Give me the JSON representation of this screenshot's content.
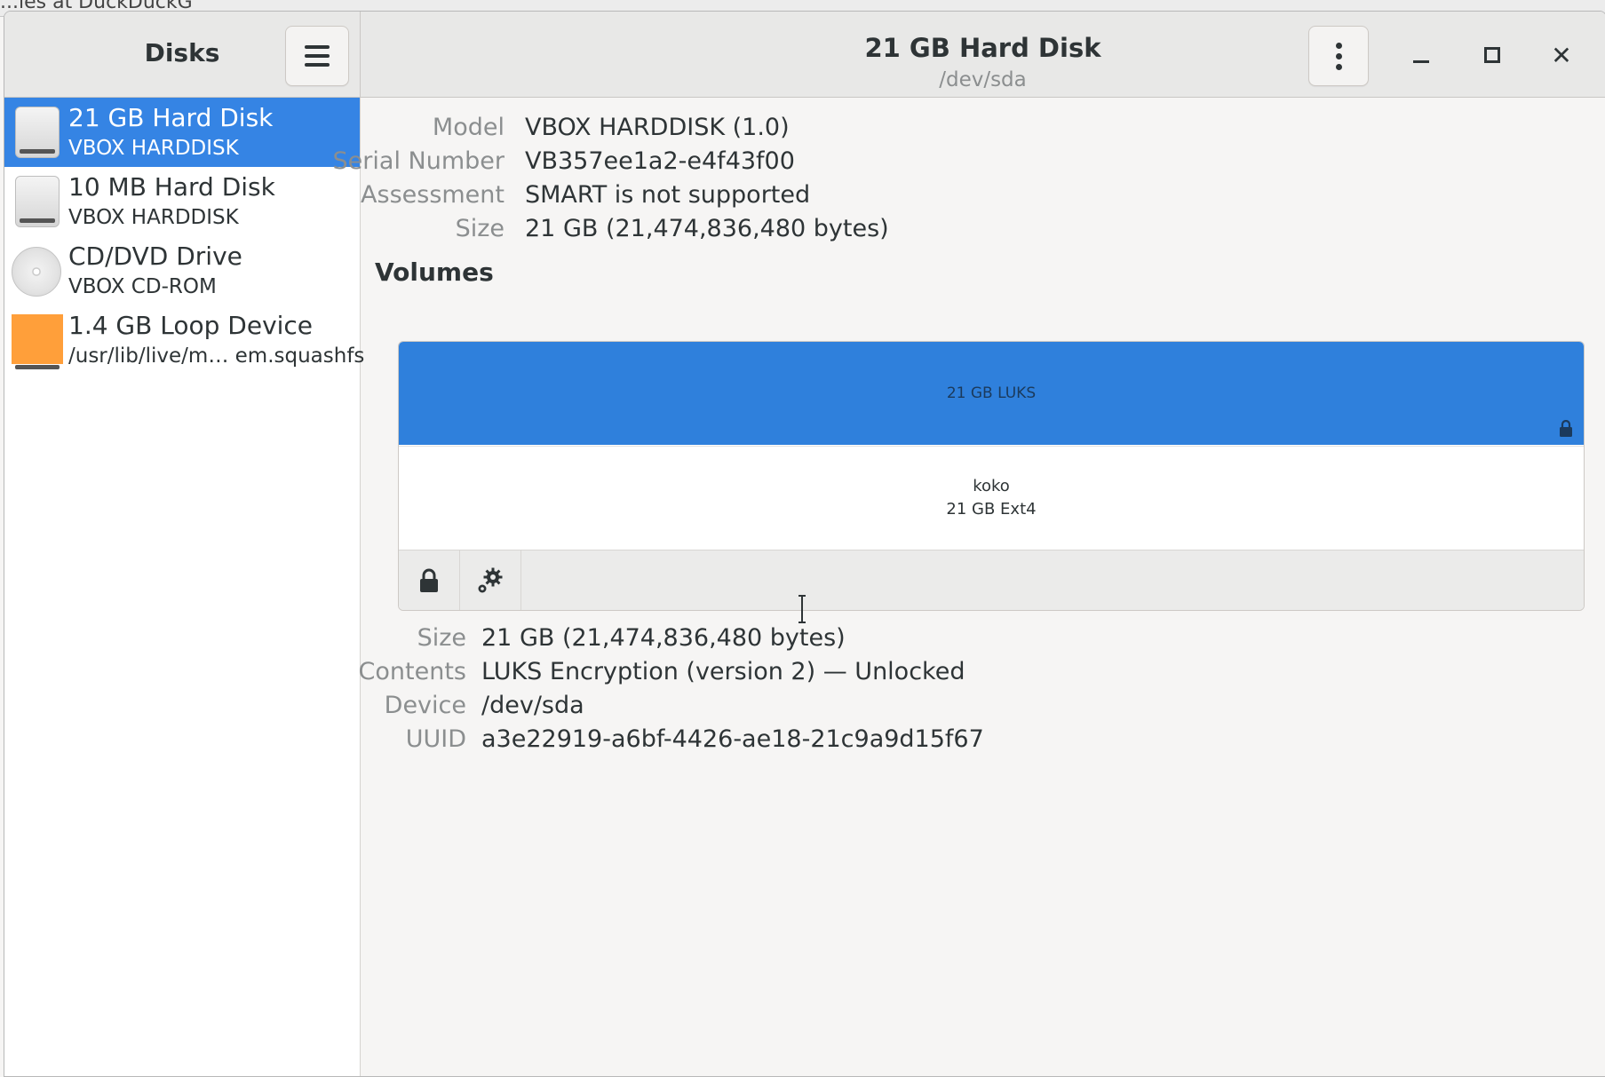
{
  "background": {
    "tab_text": "...les at DuckDuckG"
  },
  "app": {
    "title": "Disks"
  },
  "window": {
    "title": "21 GB Hard Disk",
    "subtitle": "/dev/sda"
  },
  "sidebar": {
    "items": [
      {
        "name": "21 GB Hard Disk",
        "sub": "VBOX HARDDISK",
        "icon": "hard-disk-icon",
        "selected": true
      },
      {
        "name": "10 MB Hard Disk",
        "sub": "VBOX HARDDISK",
        "icon": "hard-disk-icon",
        "selected": false
      },
      {
        "name": "CD/DVD Drive",
        "sub": "VBOX CD-ROM",
        "icon": "optical-drive-icon",
        "selected": false
      },
      {
        "name": "1.4 GB Loop Device",
        "sub": "/usr/lib/live/m… em.squashfs",
        "icon": "loop-device-icon",
        "selected": false
      }
    ]
  },
  "drive": {
    "model_label": "Model",
    "model": "VBOX HARDDISK (1.0)",
    "serial_label": "Serial Number",
    "serial": "VB357ee1a2-e4f43f00",
    "assessment_label": "Assessment",
    "assessment": "SMART is not supported",
    "size_label": "Size",
    "size": "21 GB (21,474,836,480 bytes)"
  },
  "volumes": {
    "heading": "Volumes",
    "luks_label": "21 GB LUKS",
    "fs_name": "koko",
    "fs_sub": "21 GB Ext4"
  },
  "partition": {
    "size_label": "Size",
    "size": "21 GB (21,474,836,480 bytes)",
    "contents_label": "Contents",
    "contents": "LUKS Encryption (version 2) — Unlocked",
    "device_label": "Device",
    "device": "/dev/sda",
    "uuid_label": "UUID",
    "uuid": "a3e22919-a6bf-4426-ae18-21c9a9d15f67"
  },
  "colors": {
    "accent": "#3584e4",
    "luks_bar": "#2f80dc",
    "loop_icon": "#ff9f3a"
  }
}
